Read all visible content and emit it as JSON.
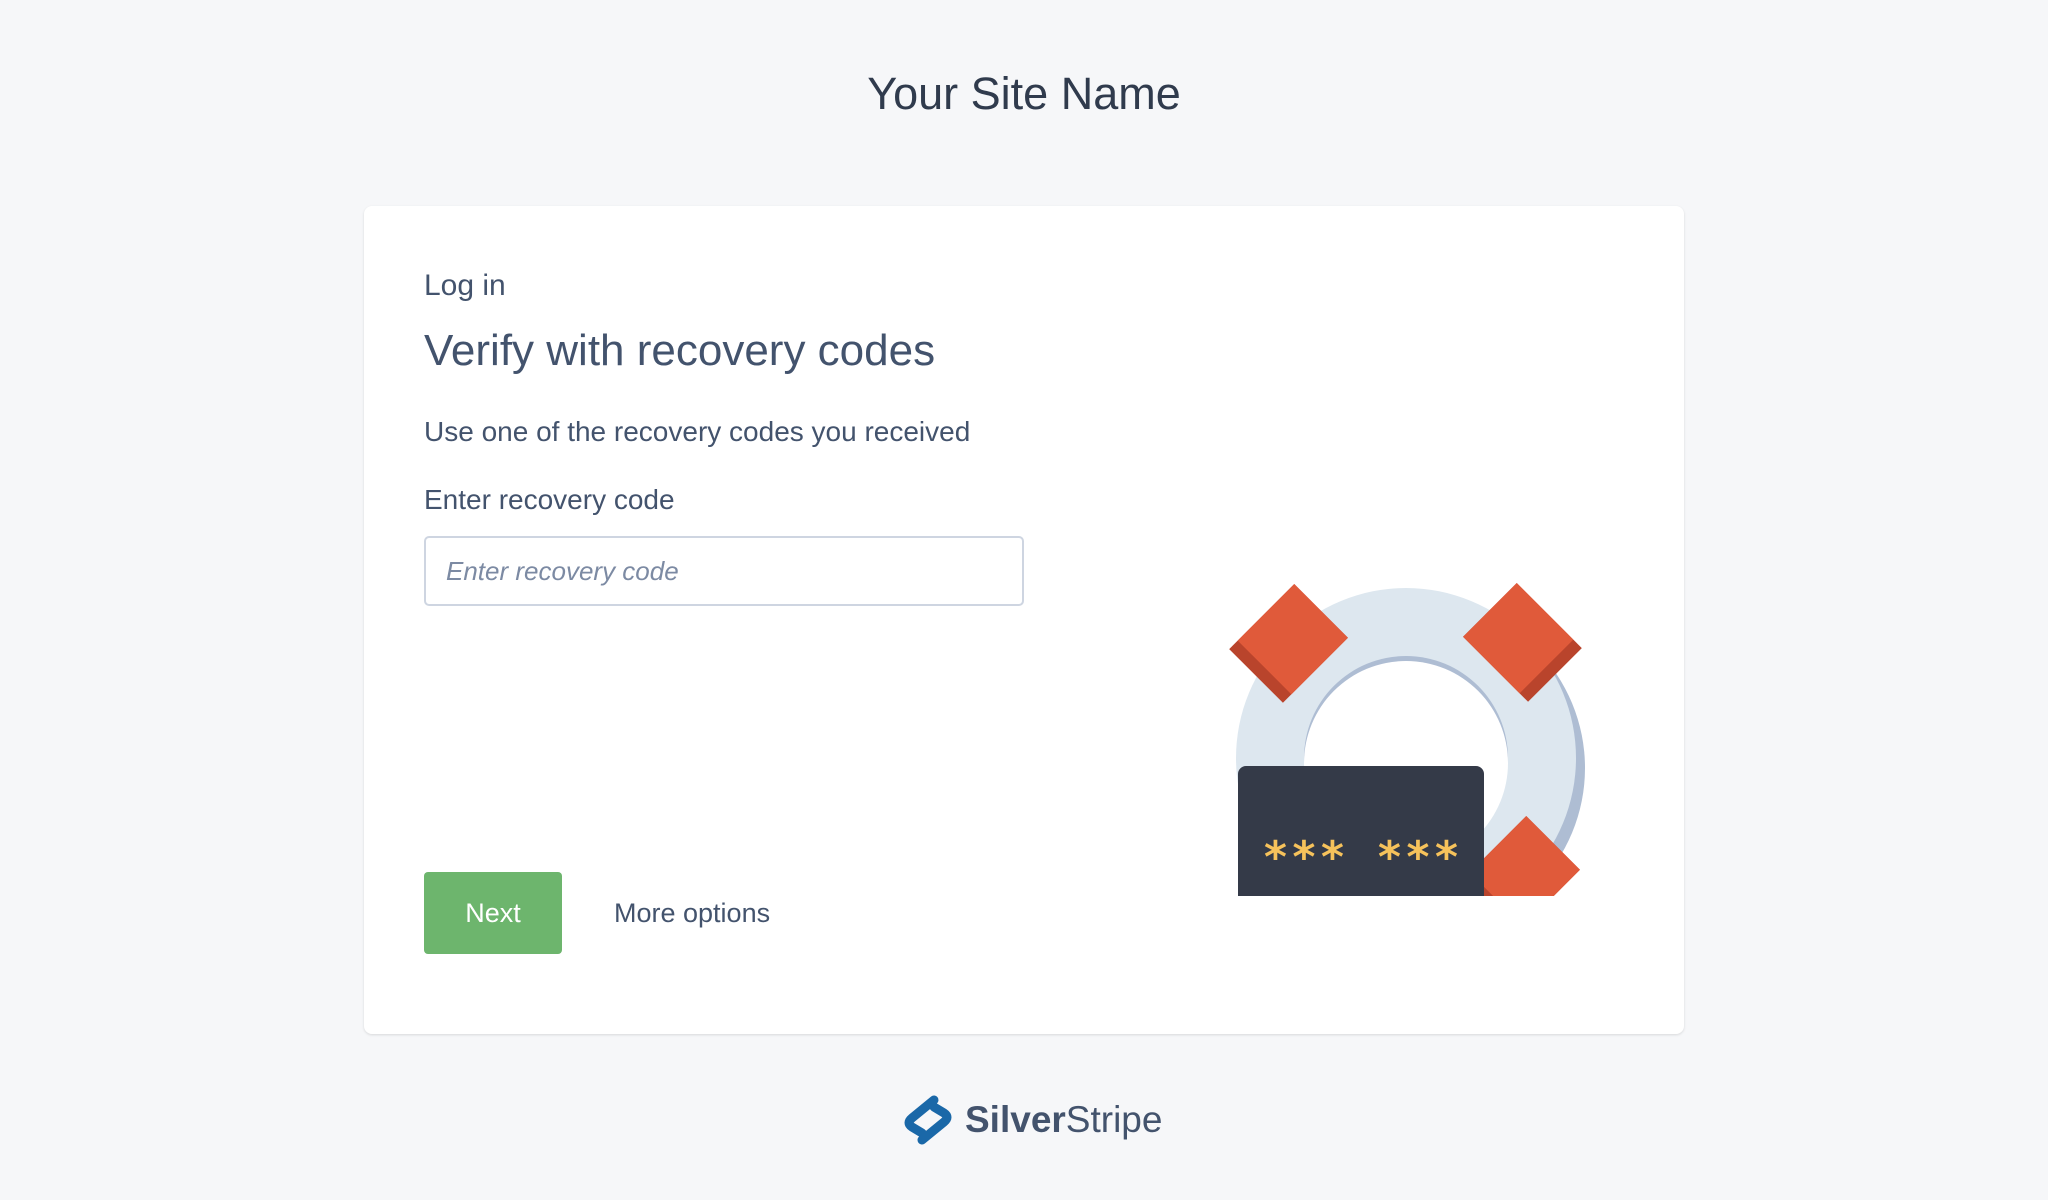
{
  "site": {
    "title": "Your Site Name"
  },
  "login": {
    "eyebrow": "Log in",
    "heading": "Verify with recovery codes",
    "description": "Use one of the recovery codes you received",
    "field_label": "Enter recovery code",
    "input_placeholder": "Enter recovery code",
    "input_value": "",
    "next_label": "Next",
    "more_options_label": "More options"
  },
  "illustration": {
    "icons": [
      "lifebuoy-icon",
      "recovery-codes-card-icon"
    ],
    "code_rows": [
      "*** ***",
      "*** ***",
      "*** ***"
    ]
  },
  "footer": {
    "brand_bold": "Silver",
    "brand_regular": "Stripe",
    "logo_icon": "silverstripe-logo-icon"
  },
  "colors": {
    "background": "#f6f7f9",
    "card": "#ffffff",
    "text": "#43536d",
    "primary_button": "#6db56d",
    "lifebuoy_ring": "#dde7ef",
    "lifebuoy_shadow": "#aebdd3",
    "lifebuoy_band": "#e05a3a",
    "codes_card": "#343a48",
    "codes_text": "#f6c25b",
    "logo_blue": "#1a68a8"
  }
}
